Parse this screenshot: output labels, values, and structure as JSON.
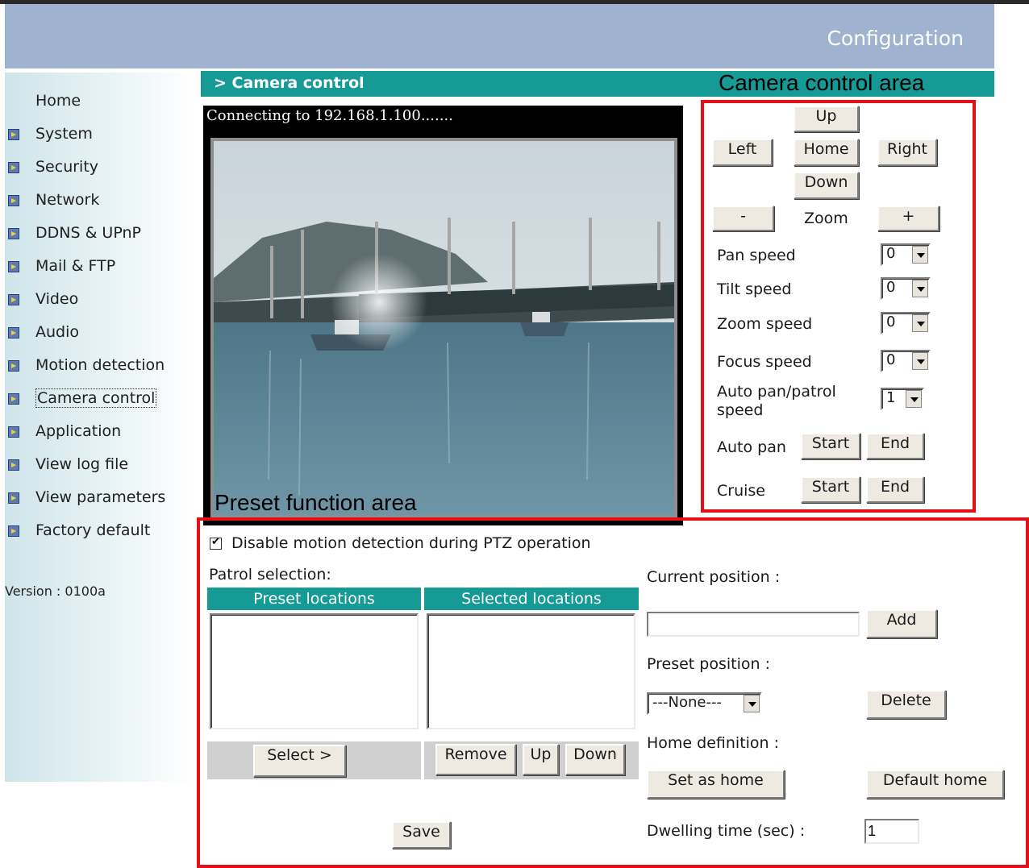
{
  "header": {
    "title": "Configuration"
  },
  "sidebar": {
    "items": [
      {
        "label": "Home",
        "arrow": false
      },
      {
        "label": "System",
        "arrow": true
      },
      {
        "label": "Security",
        "arrow": true
      },
      {
        "label": "Network",
        "arrow": true
      },
      {
        "label": "DDNS & UPnP",
        "arrow": true
      },
      {
        "label": "Mail & FTP",
        "arrow": true
      },
      {
        "label": "Video",
        "arrow": true
      },
      {
        "label": "Audio",
        "arrow": true
      },
      {
        "label": "Motion detection",
        "arrow": true
      },
      {
        "label": "Camera control",
        "arrow": true,
        "active": true
      },
      {
        "label": "Application",
        "arrow": true
      },
      {
        "label": "View log file",
        "arrow": true
      },
      {
        "label": "View parameters",
        "arrow": true
      },
      {
        "label": "Factory default",
        "arrow": true
      }
    ],
    "version": "Version : 0100a"
  },
  "section": {
    "title": "> Camera control"
  },
  "annotations": {
    "camera_area": "Camera control area",
    "preset_area": "Preset function area"
  },
  "video": {
    "status": "Connecting to 192.168.1.100......."
  },
  "camera_control": {
    "up": "Up",
    "left": "Left",
    "home": "Home",
    "right": "Right",
    "down": "Down",
    "zoom_out": "-",
    "zoom_label": "Zoom",
    "zoom_in": "+",
    "pan_speed": {
      "label": "Pan speed",
      "value": "0"
    },
    "tilt_speed": {
      "label": "Tilt speed",
      "value": "0"
    },
    "zoom_speed": {
      "label": "Zoom speed",
      "value": "0"
    },
    "focus_speed": {
      "label": "Focus speed",
      "value": "0"
    },
    "auto_pan_speed": {
      "label_line1": "Auto pan/patrol",
      "label_line2": "speed",
      "value": "1"
    },
    "auto_pan": {
      "label": "Auto pan",
      "start": "Start",
      "end": "End"
    },
    "cruise": {
      "label": "Cruise",
      "start": "Start",
      "end": "End"
    }
  },
  "preset": {
    "disable_motion_label": "Disable motion detection during PTZ operation",
    "disable_motion_checked": true,
    "patrol_selection_label": "Patrol selection:",
    "preset_locations_header": "Preset locations",
    "selected_locations_header": "Selected locations",
    "select_button": "Select >",
    "remove_button": "Remove",
    "up_button": "Up",
    "down_button": "Down",
    "save_button": "Save",
    "current_position_label": "Current position :",
    "current_position_value": "",
    "add_button": "Add",
    "preset_position_label": "Preset position :",
    "preset_position_value": "---None---",
    "delete_button": "Delete",
    "home_definition_label": "Home definition :",
    "set_as_home_button": "Set as home",
    "default_home_button": "Default home",
    "dwelling_time_label": "Dwelling time (sec) :",
    "dwelling_time_value": "1"
  },
  "colors": {
    "header_bg": "#9fb2cf",
    "teal": "#169a95",
    "annotation_red": "#e31018"
  }
}
